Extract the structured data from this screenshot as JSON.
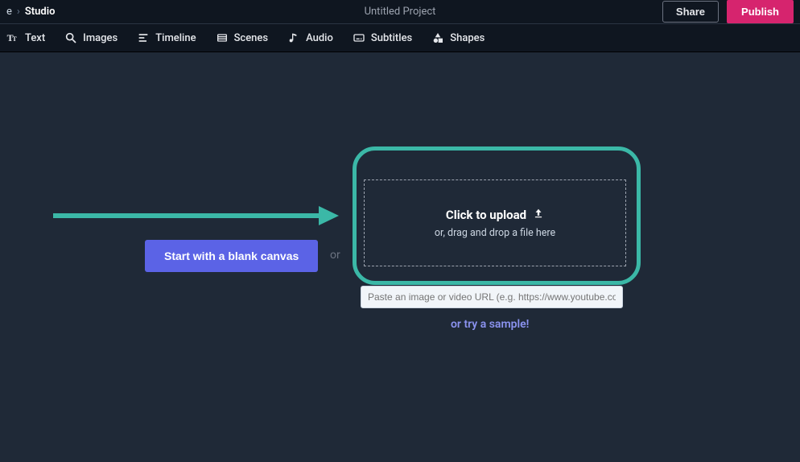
{
  "breadcrumb": {
    "prev_fragment": "e",
    "separator": "›",
    "current": "Studio"
  },
  "project_title": "Untitled Project",
  "buttons": {
    "share": "Share",
    "publish": "Publish"
  },
  "toolbar": {
    "text": "Text",
    "images": "Images",
    "timeline": "Timeline",
    "scenes": "Scenes",
    "audio": "Audio",
    "subtitles": "Subtitles",
    "shapes": "Shapes"
  },
  "main": {
    "blank_canvas": "Start with a blank canvas",
    "or": "or",
    "upload_title": "Click to upload",
    "upload_sub": "or, drag and drop a file here",
    "url_placeholder": "Paste an image or video URL (e.g. https://www.youtube.com/",
    "try_sample": "or try a sample!"
  },
  "colors": {
    "accent_teal": "#3bb8a7",
    "accent_blue": "#5b63e6",
    "accent_pink": "#d6246e",
    "bg": "#1f2937",
    "bg_dark": "#0f1620"
  }
}
